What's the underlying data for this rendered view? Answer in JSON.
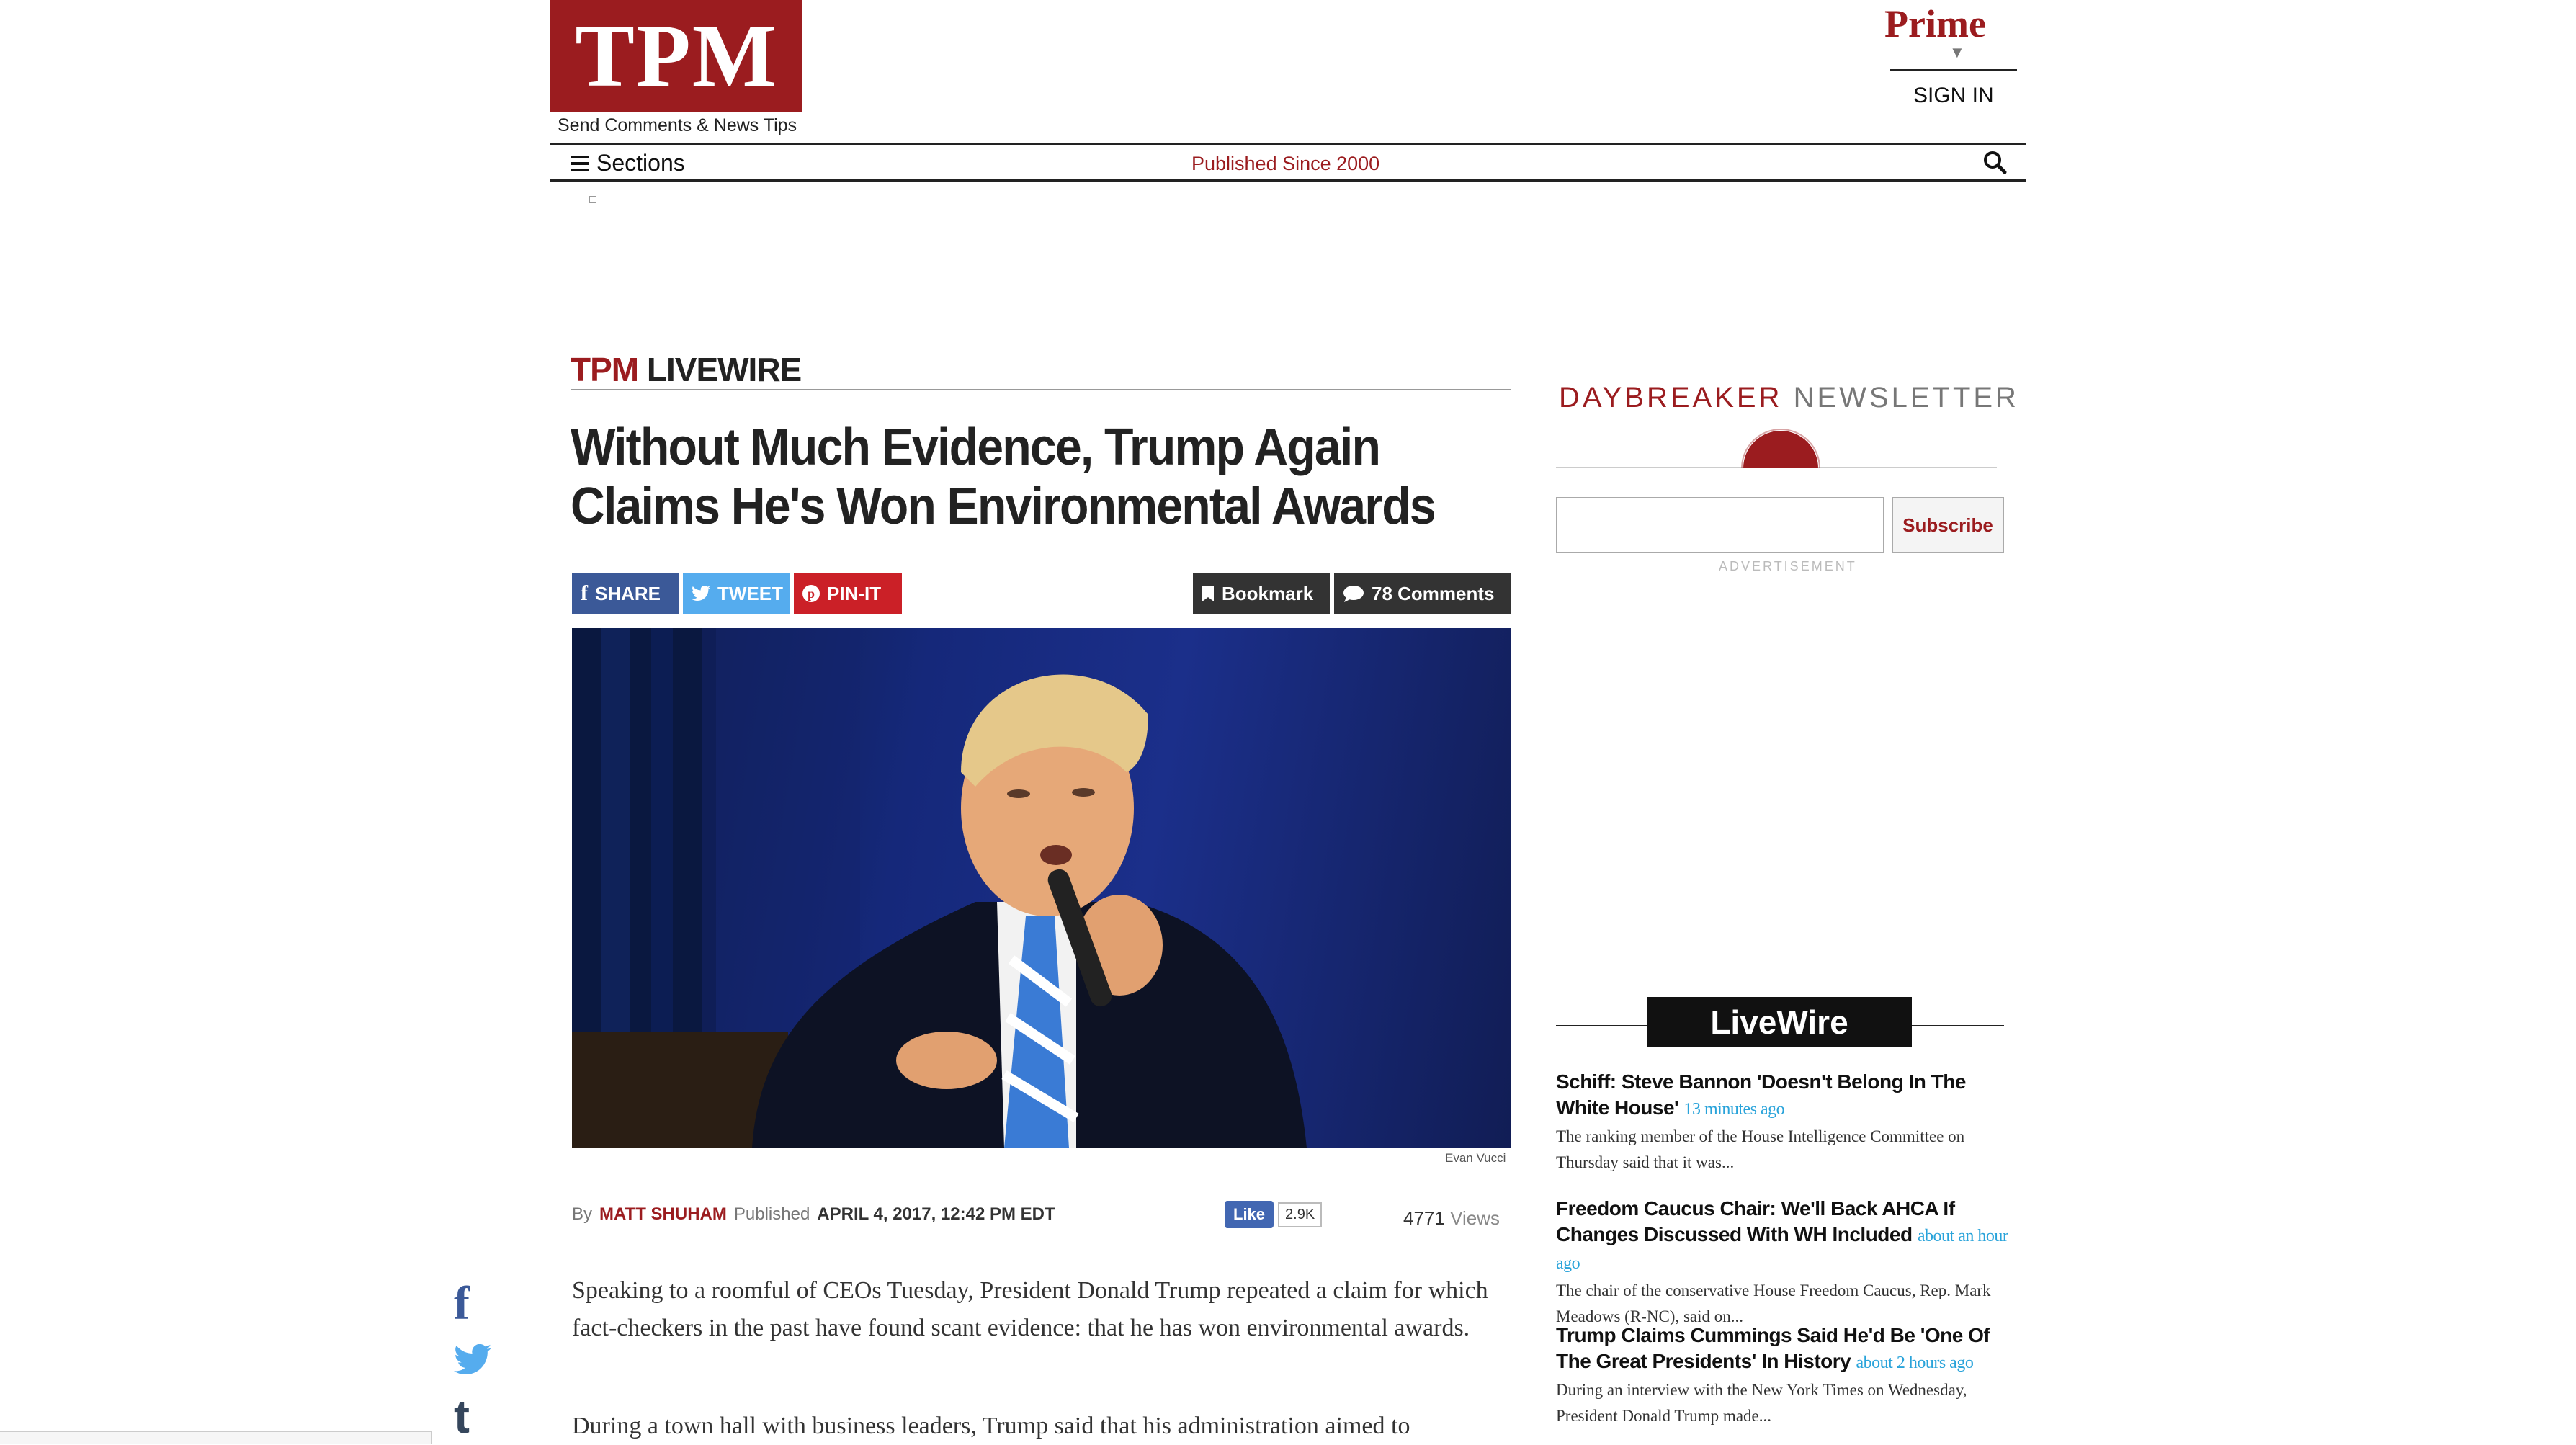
{
  "header": {
    "logo": "TPM",
    "tips_link": "Send Comments & News Tips",
    "prime": "Prime",
    "sign_in": "SIGN IN",
    "sections": "Sections",
    "tagline": "Published Since 2000"
  },
  "article": {
    "kicker_brand": "TPM",
    "kicker_section": "LIVEWIRE",
    "headline": "Without Much Evidence, Trump Again Claims He's Won Environmental Awards",
    "share": {
      "facebook": "SHARE",
      "twitter": "TWEET",
      "pinterest": "PIN-IT"
    },
    "bookmark": "Bookmark",
    "comments": "78 Comments",
    "photo_credit": "Evan Vucci",
    "by": "By",
    "author": "MATT SHUHAM",
    "published_label": "Published",
    "date": "APRIL 4, 2017, 12:42 PM EDT",
    "like_label": "Like",
    "like_count": "2.9K",
    "views_count": "4771",
    "views_label": "Views",
    "paragraph1": "Speaking to a roomful of CEOs Tuesday, President Donald Trump repeated a claim for which fact-checkers in the past have found scant evidence: that he has won environmental awards.",
    "paragraph2": "During a town hall with business leaders, Trump said that his administration aimed to"
  },
  "sidebar": {
    "newsletter_brand": "DAYBREAKER",
    "newsletter_word": "NEWSLETTER",
    "subscribe": "Subscribe",
    "advertisement": "ADVERTISEMENT",
    "livewire_title": "LiveWire",
    "items": [
      {
        "headline": "Schiff: Steve Bannon 'Doesn't Belong In The White House'",
        "time": "13 minutes ago",
        "summary": "The ranking member of the House Intelligence Committee on Thursday said that it was..."
      },
      {
        "headline": "Freedom Caucus Chair: We'll Back AHCA If Changes Discussed With WH Included",
        "time": "about an hour ago",
        "summary": "The chair of the conservative House Freedom Caucus, Rep. Mark Meadows (R-NC), said on..."
      },
      {
        "headline": "Trump Claims Cummings Said He'd Be 'One Of The Great Presidents' In History",
        "time": "about 2 hours ago",
        "summary": "During an interview with the New York Times on Wednesday, President Donald Trump made..."
      }
    ]
  },
  "colors": {
    "brand_red": "#9b1c1f",
    "facebook": "#3b5998",
    "twitter": "#55acee",
    "pinterest": "#cb2027",
    "link_blue": "#29a3da"
  }
}
